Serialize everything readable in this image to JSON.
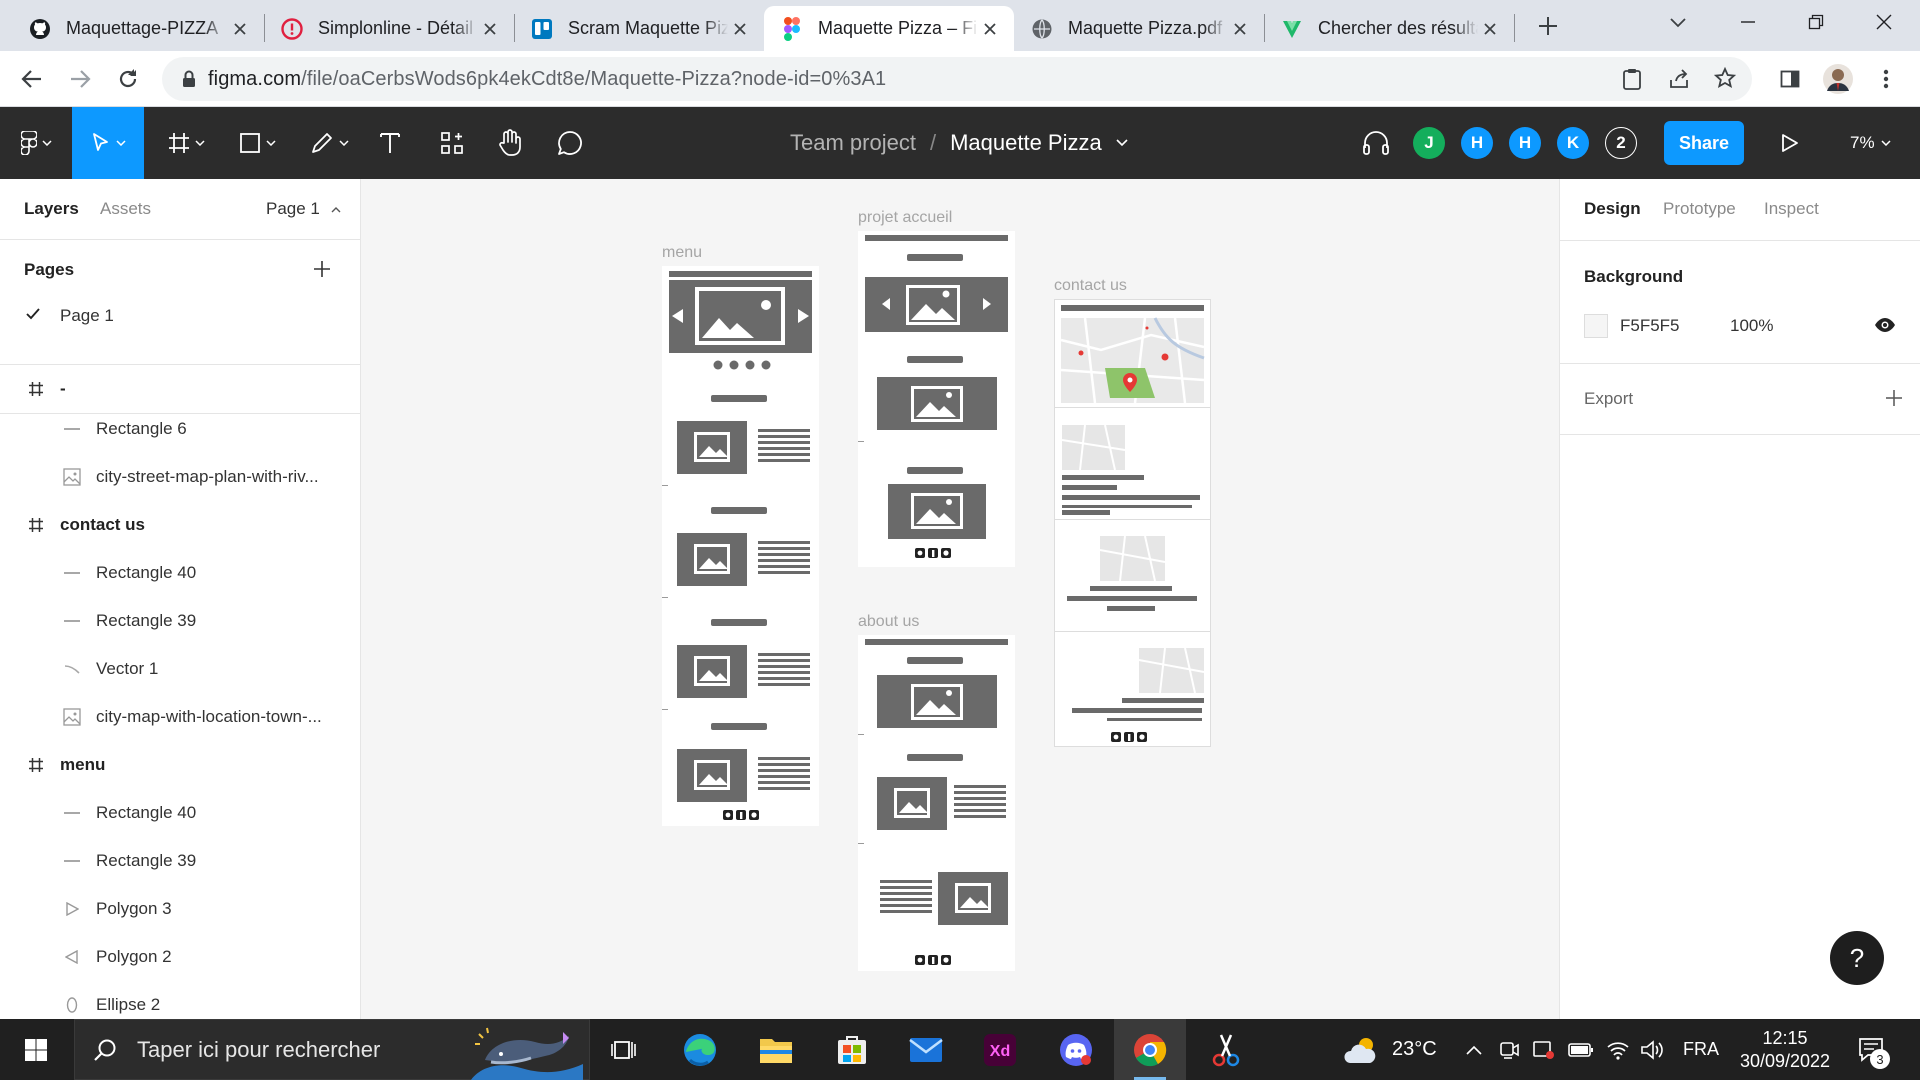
{
  "browser": {
    "tabs": [
      {
        "title": "Maquettage-PIZZA",
        "icon": "github-icon"
      },
      {
        "title": "Simplonline - Détail",
        "icon": "simplon-icon"
      },
      {
        "title": "Scram Maquette Pizza",
        "icon": "trello-icon"
      },
      {
        "title": "Maquette Pizza – Figma",
        "icon": "figma-icon",
        "active": true
      },
      {
        "title": "Maquette Pizza.pdf",
        "icon": "globe-icon"
      },
      {
        "title": "Chercher des résultats",
        "icon": "vuetify-icon"
      }
    ],
    "url_host": "figma.com",
    "url_path": "/file/oaCerbsWods6pk4ekCdt8e/Maquette-Pizza?node-id=0%3A1"
  },
  "figma": {
    "team": "Team project",
    "separator": "/",
    "file_name": "Maquette Pizza",
    "avatars": [
      {
        "letter": "J",
        "color": "#14ae5c"
      },
      {
        "letter": "H",
        "color": "#0d99ff"
      },
      {
        "letter": "H",
        "color": "#0d99ff"
      },
      {
        "letter": "K",
        "color": "#0d99ff"
      }
    ],
    "extra_users": "2",
    "share_label": "Share",
    "zoom": "7%"
  },
  "left_panel": {
    "tab_layers": "Layers",
    "tab_assets": "Assets",
    "page_selector": "Page 1",
    "pages_heading": "Pages",
    "pages": [
      "Page 1"
    ],
    "layers": [
      {
        "name": "-",
        "kind": "frame"
      },
      {
        "name": "Rectangle 6",
        "kind": "rect"
      },
      {
        "name": "city-street-map-plan-with-riv...",
        "kind": "image"
      },
      {
        "name": "contact us",
        "kind": "frame"
      },
      {
        "name": "Rectangle 40",
        "kind": "rect"
      },
      {
        "name": "Rectangle 39",
        "kind": "rect"
      },
      {
        "name": "Vector 1",
        "kind": "vector"
      },
      {
        "name": "city-map-with-location-town-...",
        "kind": "image"
      },
      {
        "name": "menu",
        "kind": "frame"
      },
      {
        "name": "Rectangle 40",
        "kind": "rect"
      },
      {
        "name": "Rectangle 39",
        "kind": "rect"
      },
      {
        "name": "Polygon 3",
        "kind": "polygon-right"
      },
      {
        "name": "Polygon 2",
        "kind": "polygon-left"
      },
      {
        "name": "Ellipse 2",
        "kind": "ellipse"
      }
    ]
  },
  "canvas": {
    "frames": {
      "menu": "menu",
      "accueil": "projet accueil",
      "contact": "contact us",
      "about": "about us"
    }
  },
  "right_panel": {
    "tab_design": "Design",
    "tab_prototype": "Prototype",
    "tab_inspect": "Inspect",
    "background_heading": "Background",
    "background_color": "F5F5F5",
    "background_opacity": "100%",
    "export_heading": "Export"
  },
  "help_label": "?",
  "taskbar": {
    "search_placeholder": "Taper ici pour rechercher",
    "temperature": "23°C",
    "language": "FRA",
    "time": "12:15",
    "date": "30/09/2022",
    "notifications": "3"
  }
}
